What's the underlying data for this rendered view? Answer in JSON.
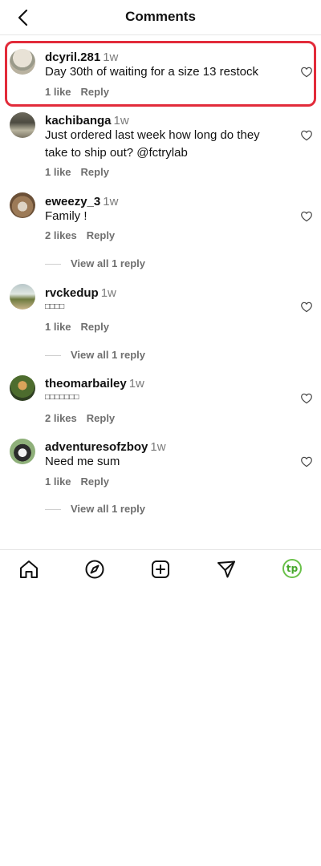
{
  "header": {
    "title": "Comments",
    "back_icon": "chevron-left-icon"
  },
  "comments": [
    {
      "username": "dcyril.281",
      "time": "1w",
      "text": "Day 30th of waiting for a size 13 restock",
      "likes": "1 like",
      "reply": "Reply",
      "highlighted": true
    },
    {
      "username": "kachibanga",
      "time": "1w",
      "text": "Just ordered last week how long do they take to ship out? @fctrylab",
      "likes": "1 like",
      "reply": "Reply"
    },
    {
      "username": "eweezy_3",
      "time": "1w",
      "text": "Family !",
      "likes": "2 likes",
      "reply": "Reply",
      "view_replies": "View all 1 reply"
    },
    {
      "username": "rvckedup",
      "time": "1w",
      "text": "□□□□",
      "likes": "1 like",
      "reply": "Reply",
      "view_replies": "View all 1 reply"
    },
    {
      "username": "theomarbailey",
      "time": "1w",
      "text": "□□□□□□□",
      "likes": "2 likes",
      "reply": "Reply"
    },
    {
      "username": "adventuresofzboy",
      "time": "1w",
      "text": "Need me sum",
      "likes": "1 like",
      "reply": "Reply",
      "view_replies": "View all 1 reply"
    }
  ],
  "nav": {
    "items": [
      "home-icon",
      "explore-compass-icon",
      "create-plus-icon",
      "direct-send-icon",
      "profile-avatar"
    ],
    "profile_initials": "tp",
    "profile_color": "#6ac14a"
  },
  "colors": {
    "highlight": "#e22b3a",
    "muted": "#7b7b7b"
  }
}
